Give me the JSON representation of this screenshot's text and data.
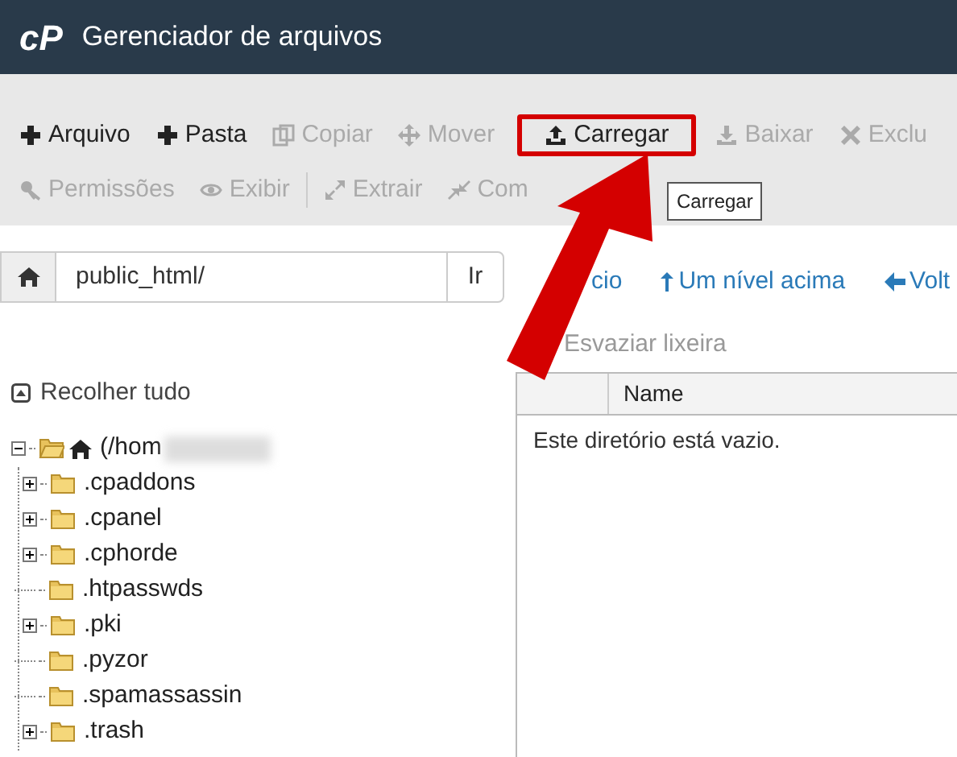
{
  "header": {
    "logo": "cP",
    "title": "Gerenciador de arquivos"
  },
  "toolbar": {
    "rows": [
      [
        {
          "label": "Arquivo",
          "disabled": false,
          "highlighted": false
        },
        {
          "label": "Pasta",
          "disabled": false,
          "highlighted": false
        },
        {
          "label": "Copiar",
          "disabled": true,
          "highlighted": false
        },
        {
          "label": "Mover",
          "disabled": true,
          "highlighted": false
        },
        {
          "label": "Carregar",
          "disabled": false,
          "highlighted": true
        },
        {
          "label": "Baixar",
          "disabled": true,
          "highlighted": false
        },
        {
          "label": "Exclu",
          "disabled": true,
          "highlighted": false
        }
      ],
      [
        {
          "label": "Permissões",
          "disabled": true,
          "highlighted": false
        },
        {
          "label": "Exibir",
          "disabled": true,
          "highlighted": false
        },
        {
          "label": "Extrair",
          "disabled": true,
          "highlighted": false
        },
        {
          "label": "Com",
          "disabled": true,
          "highlighted": false
        }
      ]
    ],
    "tooltip": "Carregar"
  },
  "path_bar": {
    "value": "public_html/",
    "button": "Ir"
  },
  "nav_links": [
    "cio",
    "Um nível acima",
    "Volt"
  ],
  "trash_link": "Esvaziar lixeira",
  "collapse_all": "Recolher tudo",
  "tree": {
    "label": "(/hom",
    "expanded": true,
    "children": [
      {
        "label": ".cpaddons",
        "expandable": true
      },
      {
        "label": ".cpanel",
        "expandable": true
      },
      {
        "label": ".cphorde",
        "expandable": true
      },
      {
        "label": ".htpasswds",
        "expandable": false
      },
      {
        "label": ".pki",
        "expandable": true
      },
      {
        "label": ".pyzor",
        "expandable": false
      },
      {
        "label": ".spamassassin",
        "expandable": false
      },
      {
        "label": ".trash",
        "expandable": true
      }
    ]
  },
  "table": {
    "columns": [
      "Name"
    ],
    "empty_message": "Este diretório está vazio."
  }
}
